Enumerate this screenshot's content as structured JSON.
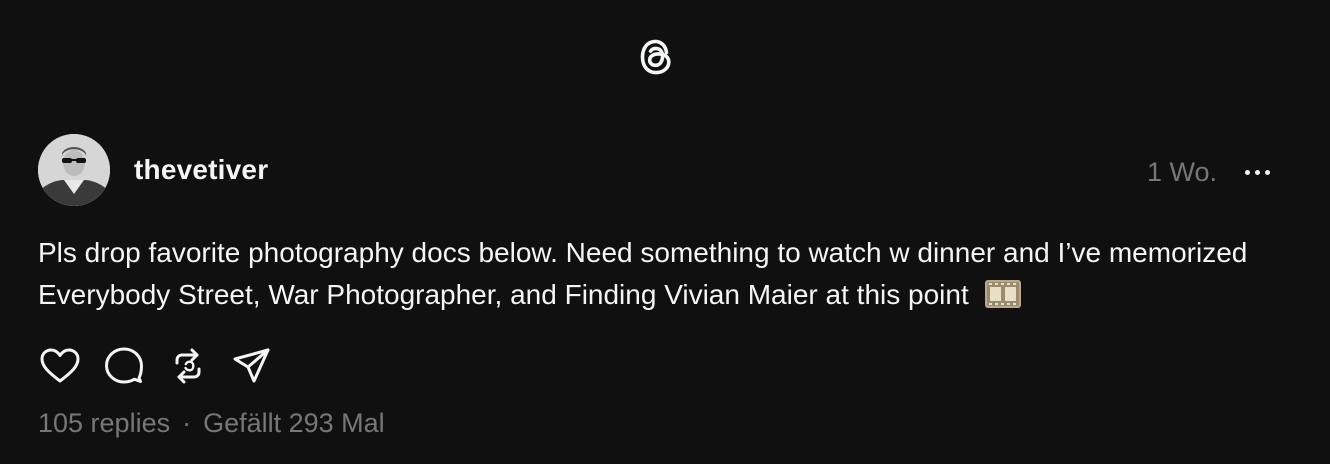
{
  "app": {
    "logo_icon": "threads-logo-icon"
  },
  "post": {
    "username": "thevetiver",
    "timestamp": "1 Wo.",
    "text": "Pls drop favorite photography docs below. Need something to watch w dinner and I’ve memorized Everybody Street, War Photographer, and Finding Vivian Maier at this point",
    "emoji_icon": "film-frames-icon",
    "stats": {
      "replies": "105 replies",
      "separator": "·",
      "likes": "Gefällt 293 Mal"
    }
  },
  "actions": [
    {
      "name": "like",
      "icon": "heart-icon"
    },
    {
      "name": "reply",
      "icon": "comment-icon"
    },
    {
      "name": "repost",
      "icon": "repost-icon"
    },
    {
      "name": "share",
      "icon": "send-icon"
    }
  ],
  "colors": {
    "background": "#101010",
    "text_primary": "#f3f5f7",
    "text_secondary": "#777777"
  }
}
